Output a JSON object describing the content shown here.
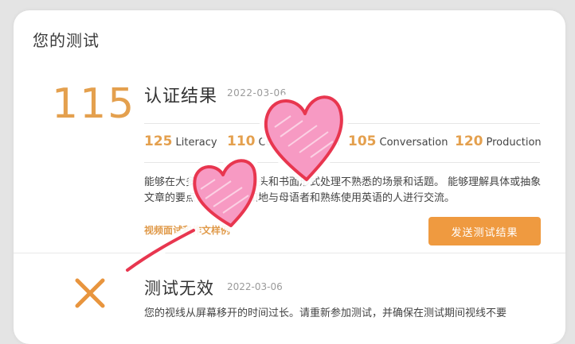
{
  "page": {
    "section_title": "您的测试"
  },
  "certified_result": {
    "overall_score": "115",
    "title": "认证结果",
    "date": "2022-03-06",
    "subscores": [
      {
        "score": "125",
        "label": "Literacy"
      },
      {
        "score": "110",
        "label": "Comprehension"
      },
      {
        "score": "105",
        "label": "Conversation"
      },
      {
        "score": "120",
        "label": "Production"
      }
    ],
    "description": "能够在大多数情况下以口头和书面形式处理不熟悉的场景和话题。 能够理解具体或抽象文章的要点，并流利自如地与母语者和熟练使用英语的人进行交流。",
    "video_link": "视频面试和作文样例",
    "send_button": "发送测试结果"
  },
  "invalid_result": {
    "title": "测试无效",
    "date": "2022-03-06",
    "description": "您的视线从屏幕移开的时间过长。请重新参加测试，并确保在测试期间视线不要",
    "icon": "x-icon",
    "icon_color": "#e8953e"
  },
  "colors": {
    "accent": "#e4a04e",
    "button": "#ef9a40",
    "heart_fill": "#f79ac3",
    "heart_outline": "#e8364f"
  },
  "decoration": {
    "sticker": "hearts-sticker"
  }
}
